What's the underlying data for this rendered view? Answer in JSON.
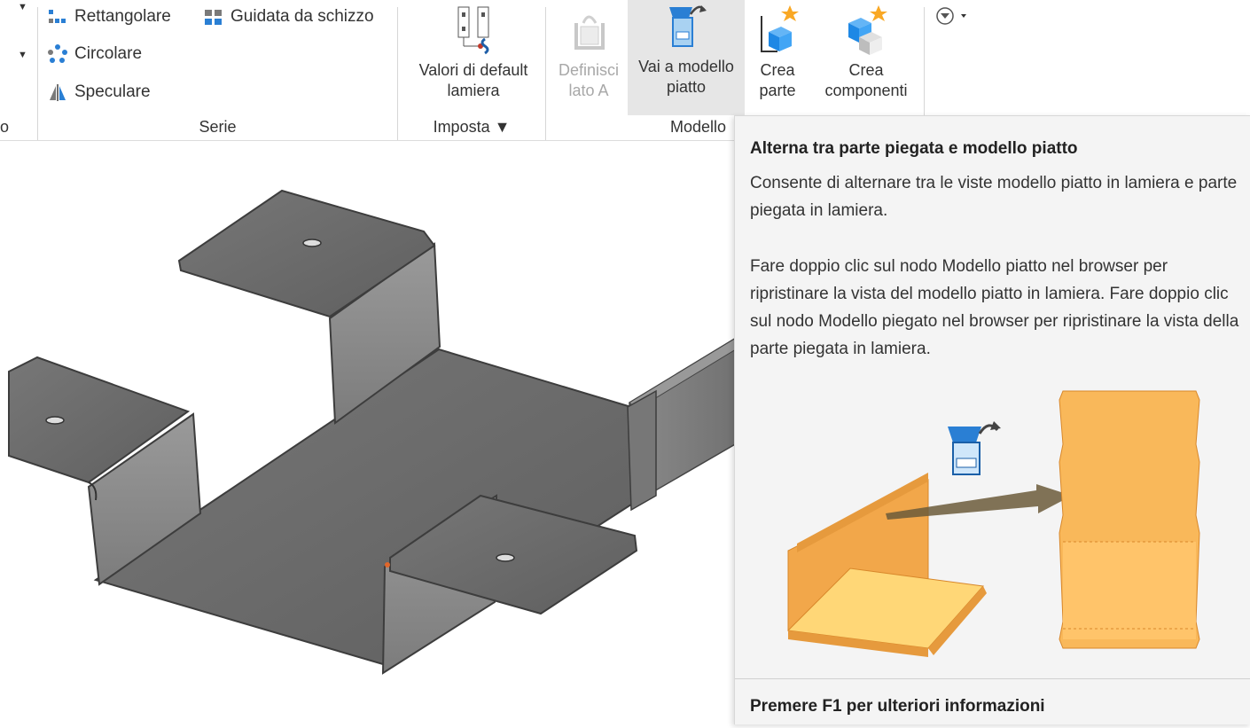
{
  "ribbon": {
    "pattern_group": {
      "label": "Serie",
      "rectangular": "Rettangolare",
      "sketch_driven": "Guidata da schizzo",
      "circular": "Circolare",
      "mirror": "Speculare"
    },
    "left_cut_label": "o",
    "setup_group": {
      "label": "Imposta ▼",
      "defaults_line1": "Valori di default",
      "defaults_line2": "lamiera"
    },
    "flat_group": {
      "label": "Modello",
      "define_line1": "Definisci",
      "define_line2": "lato A",
      "goto_line1": "Vai a modello",
      "goto_line2": "piatto",
      "part_line1": "Crea",
      "part_line2": "parte",
      "comp_line1": "Crea",
      "comp_line2": "componenti"
    }
  },
  "tooltip": {
    "title": "Alterna tra parte piegata e modello piatto",
    "para1": "Consente di alternare tra le viste modello piatto in lamiera e parte piegata in lamiera.",
    "para2": "Fare doppio clic sul nodo Modello piatto nel browser per ripristinare la vista del modello piatto in lamiera. Fare doppio clic sul nodo Modello piegato nel browser per ripristinare la vista della parte piegata in lamiera.",
    "footer": "Premere F1 per ulteriori informazioni"
  },
  "colors": {
    "sheet_metal_top": "#6b6b6b",
    "sheet_metal_side": "#8a8a8a",
    "flat_pattern": "#f7b24a",
    "accent_blue": "#2a7fd4"
  }
}
